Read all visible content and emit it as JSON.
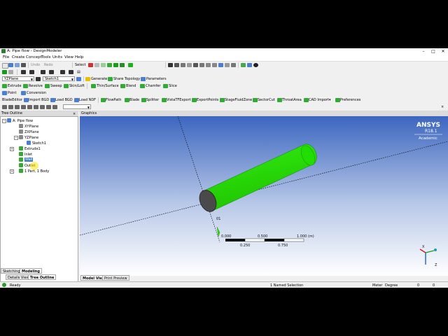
{
  "window": {
    "title": "A: Pipe flow - DesignModeler"
  },
  "menu": [
    "File",
    "Create",
    "Concept",
    "Tools",
    "Units",
    "View",
    "Help"
  ],
  "toolbar1": {
    "undo": "Undo",
    "redo": "Redo",
    "select": "Select"
  },
  "toolbar3": {
    "plane": "YZPlane",
    "sketch": "Sketch1",
    "generate": "Generate",
    "share_topology": "Share Topology",
    "parameters": "Parameters"
  },
  "toolbar4": {
    "extrude": "Extrude",
    "revolve": "Revolve",
    "sweep": "Sweep",
    "skin_loft": "Skin/Loft",
    "thin_surface": "Thin/Surface",
    "blend": "Blend",
    "chamfer": "Chamfer",
    "slice": "Slice"
  },
  "toolbar5": {
    "point": "Point",
    "conversion": "Conversion"
  },
  "toolbar6": {
    "blade_editor": "BladeEditor",
    "import_bgd": "Import BGD",
    "load_bgd": "Load BGD",
    "load_ndf": "Load NDF",
    "flowpath": "FlowPath",
    "blade": "Blade",
    "splitter": "Splitter",
    "vista_tf_export": "VistaTFExport",
    "export_points": "ExportPoints",
    "stage_fluid_zone": "StageFluidZone",
    "sector_cut": "SectorCut",
    "throat_area": "ThroatArea",
    "cad_import": "CAD Import",
    "preferences": "Preferences"
  },
  "tree_outline": {
    "header": "Tree Outline",
    "items": [
      {
        "label": "A: Pipe flow"
      },
      {
        "label": "XYPlane"
      },
      {
        "label": "ZXPlane"
      },
      {
        "label": "YZPlane"
      },
      {
        "label": "Sketch1"
      },
      {
        "label": "Extrude1"
      },
      {
        "label": "Inlet"
      },
      {
        "label": "Wall"
      },
      {
        "label": "Outlet"
      },
      {
        "label": "1 Part, 1 Body"
      }
    ]
  },
  "left_tabs": {
    "sketching": "Sketching",
    "modeling": "Modeling"
  },
  "bottom_tabs": {
    "details_view": "Details View",
    "tree_outline": "Tree Outline"
  },
  "graphics": {
    "header": "Graphics",
    "ansys_logo": "ANSYS",
    "version": "R18.1",
    "edition": "Academic",
    "point_label": "01",
    "scale_top": [
      "0.000",
      "0.500",
      "1.000 (m)"
    ],
    "scale_bottom": [
      "0.250",
      "0.750"
    ],
    "tabs": {
      "model_view": "Model View",
      "print_preview": "Print Preview"
    },
    "colors": {
      "background_top": "#3c66bf",
      "background_bottom": "#ffffff",
      "pipe": "#22dd00"
    }
  },
  "status": {
    "ready": "Ready",
    "selection": "1 Named Selection",
    "units_length": "Meter",
    "units_angle": "Degree",
    "v1": "0",
    "v2": "0"
  }
}
